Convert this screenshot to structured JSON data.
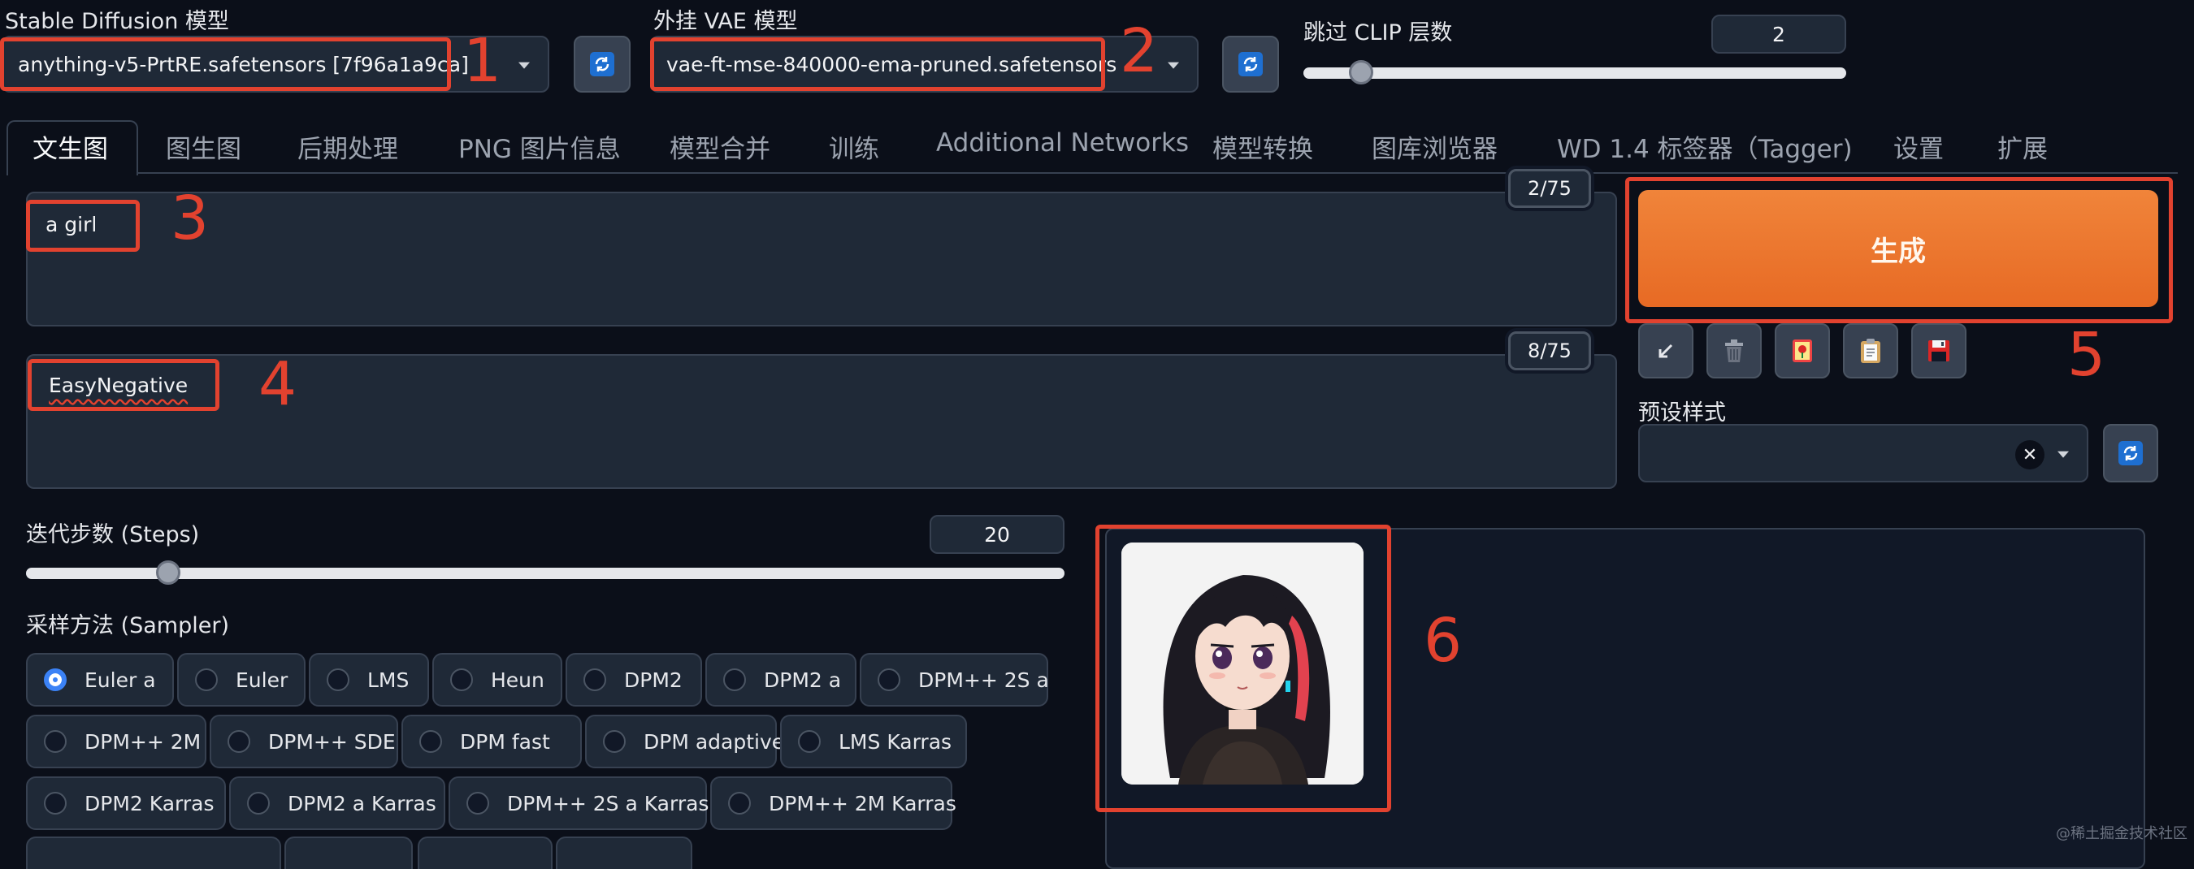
{
  "top": {
    "sd_model": {
      "label": "Stable Diffusion 模型",
      "value": "anything-v5-PrtRE.safetensors [7f96a1a9ca]"
    },
    "vae": {
      "label": "外挂 VAE 模型",
      "value": "vae-ft-mse-840000-ema-pruned.safetensors"
    },
    "clip_skip": {
      "label": "跳过 CLIP 层数",
      "value": "2"
    }
  },
  "tabs": [
    "文生图",
    "图生图",
    "后期处理",
    "PNG 图片信息",
    "模型合并",
    "训练",
    "Additional Networks",
    "模型转换",
    "图库浏览器",
    "WD 1.4 标签器（Tagger)",
    "设置",
    "扩展"
  ],
  "prompt": {
    "text": "a girl",
    "counter": "2/75"
  },
  "negative_prompt": {
    "text": "EasyNegative",
    "counter": "8/75"
  },
  "generate": {
    "label": "生成"
  },
  "styles": {
    "label": "预设样式"
  },
  "steps": {
    "label": "迭代步数 (Steps)",
    "value": "20"
  },
  "sampler": {
    "label": "采样方法 (Sampler)",
    "selected": "Euler a",
    "options": [
      "Euler a",
      "Euler",
      "LMS",
      "Heun",
      "DPM2",
      "DPM2 a",
      "DPM++ 2S a",
      "DPM++ 2M",
      "DPM++ SDE",
      "DPM fast",
      "DPM adaptive",
      "LMS Karras",
      "DPM2 Karras",
      "DPM2 a Karras",
      "DPM++ 2S a Karras",
      "DPM++ 2M Karras"
    ]
  },
  "annotations": [
    "1",
    "2",
    "3",
    "4",
    "5",
    "6"
  ],
  "watermark": "@稀土掘金技术社区",
  "colors": {
    "accent": "#e76a24",
    "annotation": "#e2422f",
    "background": "#0b0f19",
    "selected": "#3b82f6"
  }
}
